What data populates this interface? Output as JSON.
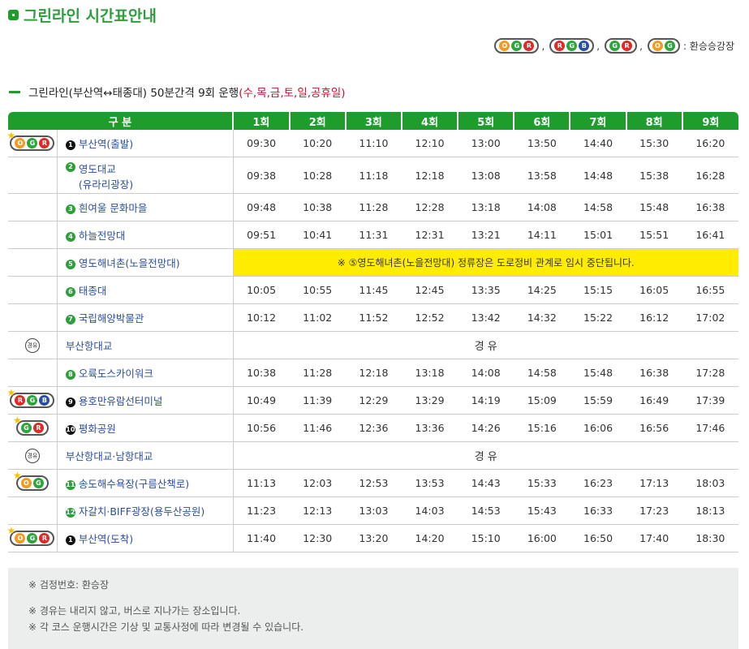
{
  "title": "그린라인 시간표안내",
  "legend": {
    "sep": ",",
    "text": ": 환승승강장"
  },
  "subtitle": {
    "main": "그린라인(부산역↔태종대) 50분간격 9회 운행",
    "days": "(수,목,금,토,일,공휴일)"
  },
  "header": [
    "구 분",
    "1회",
    "2회",
    "3회",
    "4회",
    "5회",
    "6회",
    "7회",
    "8회",
    "9회"
  ],
  "rows": [
    {
      "num": "1",
      "name": "부산역(출발)",
      "times": [
        "09:30",
        "10:20",
        "11:10",
        "12:10",
        "13:00",
        "13:50",
        "14:40",
        "15:30",
        "16:20"
      ]
    },
    {
      "num": "2",
      "name": "영도대교",
      "name2": "(유라리광장)",
      "times": [
        "09:38",
        "10:28",
        "11:18",
        "12:18",
        "13:08",
        "13:58",
        "14:48",
        "15:38",
        "16:28"
      ]
    },
    {
      "num": "3",
      "name": "흰여울 문화마을",
      "times": [
        "09:48",
        "10:38",
        "11:28",
        "12:28",
        "13:18",
        "14:08",
        "14:58",
        "15:48",
        "16:38"
      ]
    },
    {
      "num": "4",
      "name": "하늘전망대",
      "times": [
        "09:51",
        "10:41",
        "11:31",
        "12:31",
        "13:21",
        "14:11",
        "15:01",
        "15:51",
        "16:41"
      ]
    },
    {
      "num": "5",
      "name": "영도해녀촌(노을전망대)",
      "notice": "※ ⑤영도해녀촌(노을전망대) 정류장은 도로정비 관계로 임시 중단됩니다."
    },
    {
      "num": "6",
      "name": "태종대",
      "times": [
        "10:05",
        "10:55",
        "11:45",
        "12:45",
        "13:35",
        "14:25",
        "15:15",
        "16:05",
        "16:55"
      ]
    },
    {
      "num": "7",
      "name": "국립해양박물관",
      "times": [
        "10:12",
        "11:02",
        "11:52",
        "12:52",
        "13:42",
        "14:32",
        "15:22",
        "16:12",
        "17:02"
      ]
    },
    {
      "name": "부산항대교",
      "via": "경 유",
      "viaIcon": "경유"
    },
    {
      "num": "8",
      "name": "오륙도스카이워크",
      "times": [
        "10:38",
        "11:28",
        "12:18",
        "13:18",
        "14:08",
        "14:58",
        "15:48",
        "16:38",
        "17:28"
      ]
    },
    {
      "num": "9",
      "name": "용호만유람선터미널",
      "times": [
        "10:49",
        "11:39",
        "12:29",
        "13:29",
        "14:19",
        "15:09",
        "15:59",
        "16:49",
        "17:39"
      ]
    },
    {
      "num": "10",
      "name": "평화공원",
      "times": [
        "10:56",
        "11:46",
        "12:36",
        "13:36",
        "14:26",
        "15:16",
        "16:06",
        "16:56",
        "17:46"
      ]
    },
    {
      "name": "부산항대교·남항대교",
      "via": "경 유",
      "viaIcon": "경유"
    },
    {
      "num": "11",
      "name": "송도해수욕장(구름산책로)",
      "times": [
        "11:13",
        "12:03",
        "12:53",
        "13:53",
        "14:43",
        "15:33",
        "16:23",
        "17:13",
        "18:03"
      ]
    },
    {
      "num": "12",
      "name": "자갈치·BIFF광장(용두산공원)",
      "times": [
        "11:23",
        "12:13",
        "13:03",
        "14:03",
        "14:53",
        "15:43",
        "16:33",
        "17:23",
        "18:13"
      ]
    },
    {
      "num": "1",
      "name": "부산역(도착)",
      "times": [
        "11:40",
        "12:30",
        "13:20",
        "14:20",
        "15:10",
        "16:00",
        "16:50",
        "17:40",
        "18:30"
      ]
    }
  ],
  "footer": [
    "※ 검정번호: 환승장",
    "※ 경유는 내리지 않고, 버스로 지나가는 장소입니다.",
    "※ 각 코스 운행시간은 기상 및 교통사정에 따라 변경될 수 있습니다."
  ]
}
